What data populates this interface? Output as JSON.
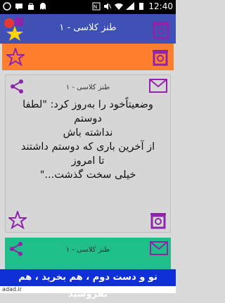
{
  "status_bar": {
    "time": "12:40",
    "left_icons": [
      "whatsapp-icon",
      "sms-icon",
      "bag-icon",
      "ghost-icon"
    ],
    "right_icons": [
      "nfc-icon",
      "mute-icon",
      "wifi-icon",
      "signal-icon",
      "battery-icon"
    ]
  },
  "header": {
    "title": "طنز کلاسی - ۱",
    "left_icon": "app-logo-shapes-icon",
    "right_icon": "delete-icon"
  },
  "cards": [
    {
      "title": "",
      "text": "",
      "color": "#ff7f2e",
      "icons": [
        "star-icon",
        "delete-icon"
      ]
    },
    {
      "title": "طنز کلاسی - ۱",
      "text_lines": [
        "وضعیتاًخود را به‌روز کرد: \"لطفا دوستم",
        "نداشته باش",
        "از آخرین باری که دوستم داشتند",
        "تا امروز",
        "خیلی سخت گذشت...\""
      ],
      "color": "#d6d6d6",
      "icons": [
        "share-icon",
        "mail-icon",
        "star-icon",
        "delete-icon"
      ]
    },
    {
      "title": "طنز کلاسی - ۱",
      "text": "",
      "color": "#20bf8a",
      "icons": [
        "share-icon",
        "mail-icon"
      ]
    }
  ],
  "banner": {
    "text": "نو و دست دوم ، هم بخرید ، هم بفروشید"
  },
  "footer": {
    "brand": "adad.ir"
  },
  "colors": {
    "header": "#3f51b5",
    "accent": "#8e24aa",
    "banner": "#0f2fd8"
  }
}
